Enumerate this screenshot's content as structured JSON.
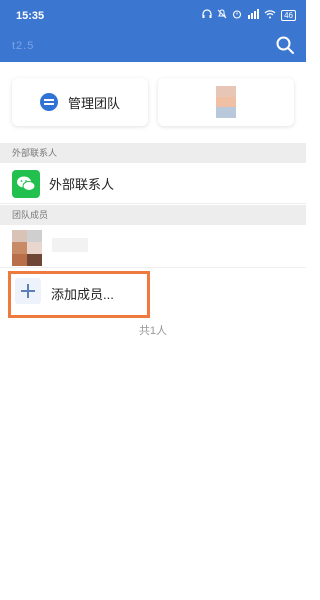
{
  "status_bar": {
    "time": "15:35",
    "icons": [
      "headphones-icon",
      "mute-icon",
      "alarm-icon",
      "network-icon",
      "wifi-icon"
    ],
    "battery": "46"
  },
  "header": {
    "title": "t2.5",
    "search_icon": "search-icon",
    "background_color": "#3b77d0"
  },
  "cards": {
    "manage_team_label": "管理团队",
    "manage_icon": "swap-icon"
  },
  "sections": {
    "external_contacts_header": "外部联系人",
    "team_members_header": "团队成员"
  },
  "external_contact": {
    "label": "外部联系人",
    "icon": "wechat-icon"
  },
  "add_member": {
    "label": "添加成员...",
    "icon": "plus-icon",
    "highlight_color": "#ee7a3d"
  },
  "member_count": "共1人"
}
